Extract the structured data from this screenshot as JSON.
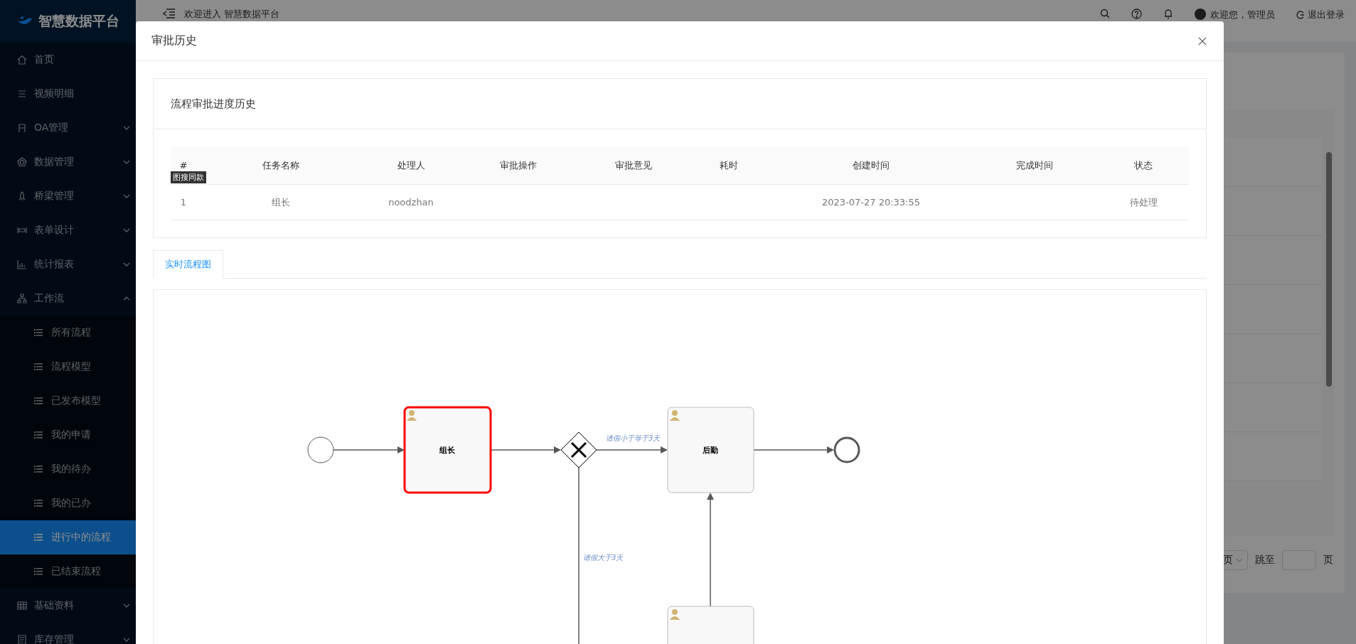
{
  "app": {
    "logo": "智慧数据平台"
  },
  "sidebar": {
    "items": [
      {
        "label": "首页",
        "kind": "link"
      },
      {
        "label": "视频明细",
        "kind": "link"
      },
      {
        "label": "OA管理",
        "kind": "group",
        "expanded": false
      },
      {
        "label": "数据管理",
        "kind": "group",
        "expanded": false
      },
      {
        "label": "桥梁管理",
        "kind": "group",
        "expanded": false
      },
      {
        "label": "表单设计",
        "kind": "group",
        "expanded": false
      },
      {
        "label": "统计报表",
        "kind": "group",
        "expanded": false
      },
      {
        "label": "工作流",
        "kind": "group",
        "expanded": true,
        "children": [
          {
            "label": "所有流程",
            "selected": false
          },
          {
            "label": "流程模型",
            "selected": false
          },
          {
            "label": "已发布模型",
            "selected": false
          },
          {
            "label": "我的申请",
            "selected": false
          },
          {
            "label": "我的待办",
            "selected": false
          },
          {
            "label": "我的已办",
            "selected": false
          },
          {
            "label": "进行中的流程",
            "selected": true
          },
          {
            "label": "已结束流程",
            "selected": false
          }
        ]
      },
      {
        "label": "基础资料",
        "kind": "group",
        "expanded": false
      },
      {
        "label": "库存管理",
        "kind": "group",
        "expanded": false
      }
    ]
  },
  "header": {
    "welcome": "欢迎进入 智慧数据平台",
    "user": "欢迎您，管理员",
    "logout": "退出登录"
  },
  "pagination": {
    "size_select": "页",
    "jump_label": "跳至",
    "unit": "页"
  },
  "modal": {
    "title": "审批历史",
    "history": {
      "title": "流程审批进度历史",
      "columns": [
        "#",
        "任务名称",
        "处理人",
        "审批操作",
        "审批意见",
        "耗时",
        "创建时间",
        "完成时间",
        "状态"
      ],
      "rows": [
        [
          "1",
          "组长",
          "noodzhan",
          "",
          "",
          "",
          "2023-07-27 20:33:55",
          "",
          "待处理"
        ]
      ]
    },
    "overlay_badge": "图搜同款",
    "tabs": [
      {
        "label": "实时流程图",
        "selected": true
      }
    ],
    "diagram": {
      "nodes": [
        {
          "kind": "start"
        },
        {
          "kind": "task",
          "label": "组长",
          "active": true
        },
        {
          "kind": "gateway"
        },
        {
          "kind": "task",
          "label": "后勤",
          "active": false
        },
        {
          "kind": "end"
        },
        {
          "kind": "task",
          "active": false
        }
      ],
      "flows": [
        {
          "label": "请假小于等于3天"
        },
        {
          "label": "请假大于3天"
        }
      ]
    }
  }
}
